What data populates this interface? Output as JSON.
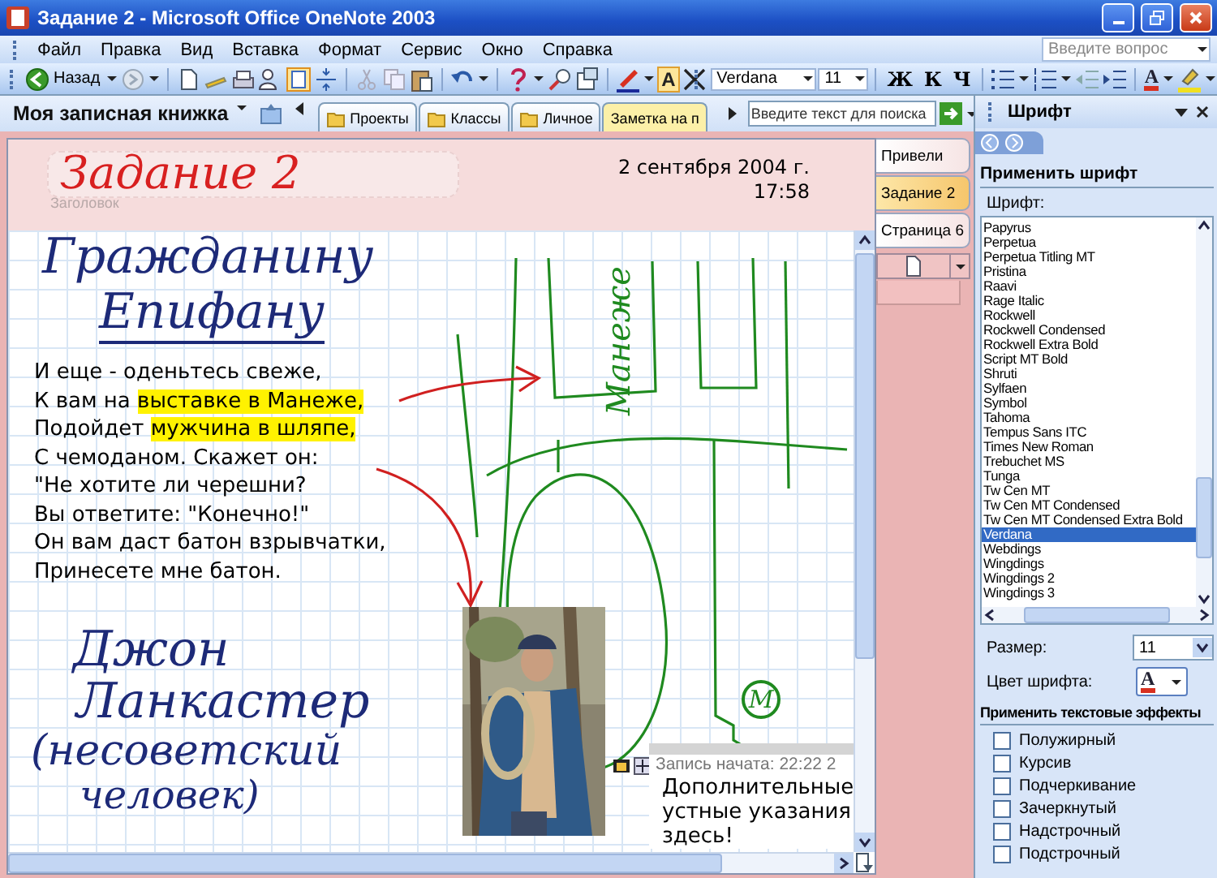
{
  "window": {
    "title": "Задание 2 - Microsoft Office OneNote 2003"
  },
  "menu": [
    "Файл",
    "Правка",
    "Вид",
    "Вставка",
    "Формат",
    "Сервис",
    "Окно",
    "Справка"
  ],
  "help_search": {
    "placeholder": "Введите вопрос"
  },
  "toolbar": {
    "back": "Назад",
    "highlight_glyph": "A",
    "font": "Verdana",
    "size": "11",
    "format_buttons": [
      "Ж",
      "К",
      "Ч"
    ],
    "font_color_glyph": "A"
  },
  "notebook": {
    "name": "Моя записная книжка",
    "sections": [
      {
        "label": "Проекты",
        "selected": false
      },
      {
        "label": "Классы",
        "selected": false
      },
      {
        "label": "Личное",
        "selected": false
      },
      {
        "label": "Заметка на п",
        "selected": true
      }
    ]
  },
  "find": {
    "placeholder": "Введите текст для поиска"
  },
  "page": {
    "title": "Задание 2",
    "title_label": "Заголовок",
    "date": "2 сентября 2004 г.",
    "time": "17:58",
    "ink_notes": [
      "Гражданину",
      "Епифану",
      "Джон",
      "Ланкастер",
      "(несоветский",
      "человек)"
    ],
    "text_lines": [
      [
        {
          "text": "И еще - оденьтесь свеже,",
          "highlight": false
        }
      ],
      [
        {
          "text": "К вам на ",
          "highlight": false
        },
        {
          "text": "выставке в Манеже,",
          "highlight": true
        }
      ],
      [
        {
          "text": "Подойдет ",
          "highlight": false
        },
        {
          "text": "мужчина в шляпе,",
          "highlight": true
        }
      ],
      [
        {
          "text": "С чемоданом. Скажет он:",
          "highlight": false
        }
      ],
      [
        {
          "text": "\"Не хотите ли черешни?",
          "highlight": false
        }
      ],
      [
        {
          "text": "Вы ответите: \"Конечно!\"",
          "highlight": false
        }
      ],
      [
        {
          "text": "Он вам даст батон взрывчатки,",
          "highlight": false
        }
      ],
      [
        {
          "text": "Принесете мне батон.",
          "highlight": false
        }
      ]
    ],
    "map_label": "Манеже",
    "map_mark": "М",
    "audio_note": {
      "started": "Запись начата: 22:22 2",
      "lines": [
        "Дополнительные",
        "устные указания",
        "здесь!"
      ]
    }
  },
  "pages": [
    {
      "label": "Привели",
      "selected": false
    },
    {
      "label": "Задание 2",
      "selected": true
    },
    {
      "label": "Страница 6",
      "selected": false
    }
  ],
  "task_pane": {
    "title": "Шрифт",
    "heading": "Применить шрифт",
    "font_label": "Шрифт:",
    "fonts": [
      {
        "name": "Papyrus",
        "selected": false
      },
      {
        "name": "Perpetua",
        "selected": false
      },
      {
        "name": "Perpetua Titling MT",
        "selected": false
      },
      {
        "name": "Pristina",
        "selected": false
      },
      {
        "name": "Raavi",
        "selected": false
      },
      {
        "name": "Rage Italic",
        "selected": false
      },
      {
        "name": "Rockwell",
        "selected": false
      },
      {
        "name": "Rockwell Condensed",
        "selected": false
      },
      {
        "name": "Rockwell Extra Bold",
        "selected": false
      },
      {
        "name": "Script MT Bold",
        "selected": false
      },
      {
        "name": "Shruti",
        "selected": false
      },
      {
        "name": "Sylfaen",
        "selected": false
      },
      {
        "name": "Symbol",
        "selected": false
      },
      {
        "name": "Tahoma",
        "selected": false
      },
      {
        "name": "Tempus Sans ITC",
        "selected": false
      },
      {
        "name": "Times New Roman",
        "selected": false
      },
      {
        "name": "Trebuchet MS",
        "selected": false
      },
      {
        "name": "Tunga",
        "selected": false
      },
      {
        "name": "Tw Cen MT",
        "selected": false
      },
      {
        "name": "Tw Cen MT Condensed",
        "selected": false
      },
      {
        "name": "Tw Cen MT Condensed Extra Bold",
        "selected": false
      },
      {
        "name": "Verdana",
        "selected": true
      },
      {
        "name": "Webdings",
        "selected": false
      },
      {
        "name": "Wingdings",
        "selected": false
      },
      {
        "name": "Wingdings 2",
        "selected": false
      },
      {
        "name": "Wingdings 3",
        "selected": false
      }
    ],
    "size_label": "Размер:",
    "size": "11",
    "color_label": "Цвет шрифта:",
    "color_glyph": "A",
    "effects_heading": "Применить текстовые эффекты",
    "effects": [
      {
        "label": "Полужирный",
        "checked": false
      },
      {
        "label": "Курсив",
        "checked": false
      },
      {
        "label": "Подчеркивание",
        "checked": false
      },
      {
        "label": "Зачеркнутый",
        "checked": false
      },
      {
        "label": "Надстрочный",
        "checked": false
      },
      {
        "label": "Подстрочный",
        "checked": false
      }
    ]
  }
}
